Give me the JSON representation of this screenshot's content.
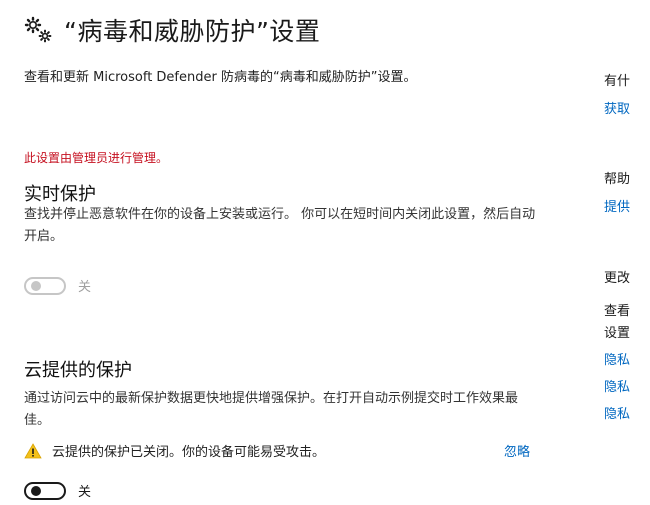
{
  "header": {
    "icon": "gear-icon",
    "title": "“病毒和威胁防护”设置",
    "subtitle": "查看和更新 Microsoft Defender 防病毒的“病毒和威胁防护”设置。"
  },
  "managed_notice": "此设置由管理员进行管理。",
  "realtime": {
    "heading": "实时保护",
    "description": "查找并停止恶意软件在你的设备上安装或运行。 你可以在短时间内关闭此设置，然后自动开启。",
    "toggle_state": "关"
  },
  "cloud": {
    "heading": "云提供的保护",
    "description": "通过访问云中的最新保护数据更快地提供增强保护。在打开自动示例提交时工作效果最佳。",
    "warning_icon": "warning-icon",
    "warning_text": "云提供的保护已关闭。你的设备可能易受攻击。",
    "dismiss_label": "忽略",
    "toggle_state": "关"
  },
  "sidebar": {
    "item1": "有什",
    "link1": "获取",
    "item2": "帮助",
    "link2": "提供",
    "item3": "更改",
    "item4": "查看",
    "item5": "设置",
    "link3": "隐私",
    "link4": "隐私",
    "link5": "隐私"
  },
  "colors": {
    "accent": "#0067c0",
    "managed_red": "#c50f1f",
    "warning_yellow": "#f3c11b"
  }
}
